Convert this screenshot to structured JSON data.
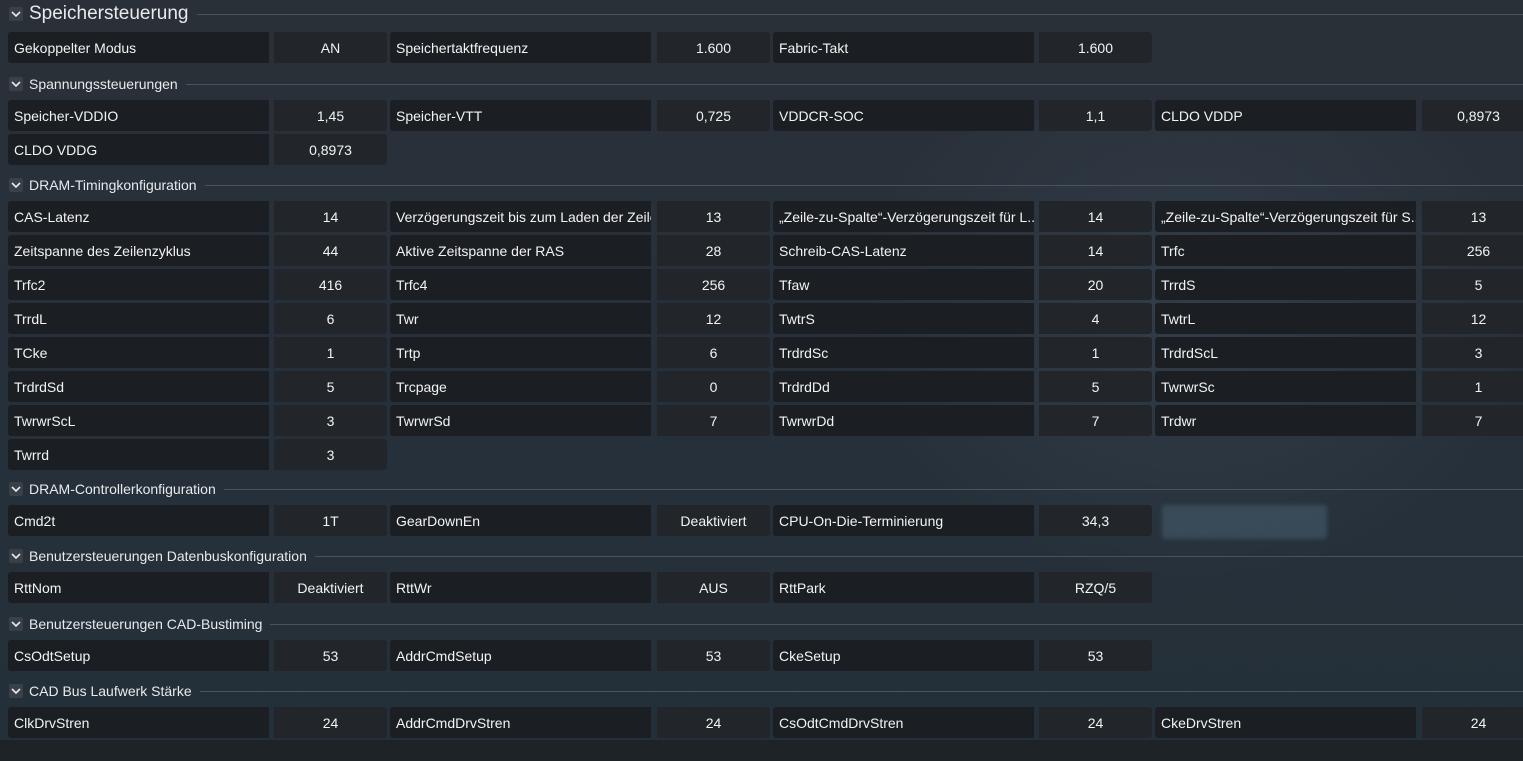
{
  "sections": [
    {
      "title": "Speichersteuerung",
      "rows": [
        [
          [
            "Gekoppelter Modus",
            "AN"
          ],
          [
            "Speichertaktfrequenz",
            "1.600"
          ],
          [
            "Fabric-Takt",
            "1.600"
          ]
        ]
      ]
    },
    {
      "title": "Spannungssteuerungen",
      "rows": [
        [
          [
            "Speicher-VDDIO",
            "1,45"
          ],
          [
            "Speicher-VTT",
            "0,725"
          ],
          [
            "VDDCR-SOC",
            "1,1"
          ],
          [
            "CLDO VDDP",
            "0,8973"
          ]
        ],
        [
          [
            "CLDO VDDG",
            "0,8973"
          ]
        ]
      ]
    },
    {
      "title": "DRAM-Timingkonfiguration",
      "rows": [
        [
          [
            "CAS-Latenz",
            "14"
          ],
          [
            "Verzögerungszeit bis zum Laden der Zeile",
            "13"
          ],
          [
            "„Zeile-zu-Spalte“-Verzögerungszeit für L...",
            "14"
          ],
          [
            "„Zeile-zu-Spalte“-Verzögerungszeit für S...",
            "13"
          ]
        ],
        [
          [
            "Zeitspanne des Zeilenzyklus",
            "44"
          ],
          [
            "Aktive Zeitspanne der RAS",
            "28"
          ],
          [
            "Schreib-CAS-Latenz",
            "14"
          ],
          [
            "Trfc",
            "256"
          ]
        ],
        [
          [
            "Trfc2",
            "416"
          ],
          [
            "Trfc4",
            "256"
          ],
          [
            "Tfaw",
            "20"
          ],
          [
            "TrrdS",
            "5"
          ]
        ],
        [
          [
            "TrrdL",
            "6"
          ],
          [
            "Twr",
            "12"
          ],
          [
            "TwtrS",
            "4"
          ],
          [
            "TwtrL",
            "12"
          ]
        ],
        [
          [
            "TCke",
            "1"
          ],
          [
            "Trtp",
            "6"
          ],
          [
            "TrdrdSc",
            "1"
          ],
          [
            "TrdrdScL",
            "3"
          ]
        ],
        [
          [
            "TrdrdSd",
            "5"
          ],
          [
            "Trcpage",
            "0"
          ],
          [
            "TrdrdDd",
            "5"
          ],
          [
            "TwrwrSc",
            "1"
          ]
        ],
        [
          [
            "TwrwrScL",
            "3"
          ],
          [
            "TwrwrSd",
            "7"
          ],
          [
            "TwrwrDd",
            "7"
          ],
          [
            "Trdwr",
            "7"
          ]
        ],
        [
          [
            "Twrrd",
            "3"
          ]
        ]
      ]
    },
    {
      "title": "DRAM-Controllerkonfiguration",
      "rows": [
        [
          [
            "Cmd2t",
            "1T"
          ],
          [
            "GearDownEn",
            "Deaktiviert"
          ],
          [
            "CPU-On-Die-Terminierung",
            "34,3"
          ]
        ]
      ]
    },
    {
      "title": "Benutzersteuerungen Datenbuskonfiguration",
      "rows": [
        [
          [
            "RttNom",
            "Deaktiviert"
          ],
          [
            "RttWr",
            "AUS"
          ],
          [
            "RttPark",
            "RZQ/5"
          ]
        ]
      ]
    },
    {
      "title": "Benutzersteuerungen CAD-Bustiming",
      "rows": [
        [
          [
            "CsOdtSetup",
            "53"
          ],
          [
            "AddrCmdSetup",
            "53"
          ],
          [
            "CkeSetup",
            "53"
          ]
        ]
      ]
    },
    {
      "title": "CAD Bus Laufwerk Stärke",
      "rows": [
        [
          [
            "ClkDrvStren",
            "24"
          ],
          [
            "AddrCmdDrvStren",
            "24"
          ],
          [
            "CsOdtCmdDrvStren",
            "24"
          ],
          [
            "CkeDrvStren",
            "24"
          ]
        ]
      ]
    }
  ]
}
